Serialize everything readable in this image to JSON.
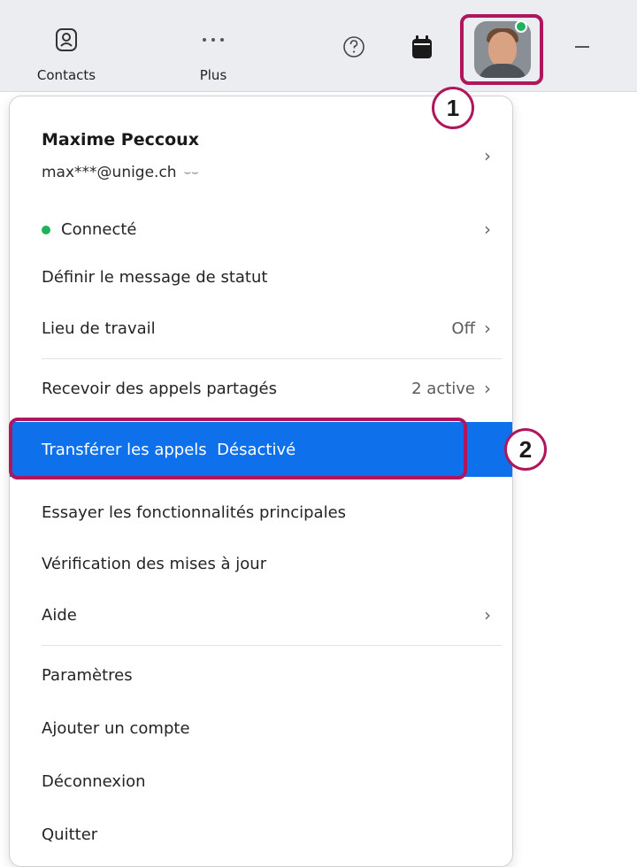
{
  "toolbar": {
    "contacts_label": "Contacts",
    "plus_label": "Plus"
  },
  "annotations": {
    "badge_1": "1",
    "badge_2": "2",
    "highlight_color": "#b0165c"
  },
  "profile": {
    "name": "Maxime Peccoux",
    "email": "max***@unige.ch",
    "presence_color": "#21b35b"
  },
  "menu": {
    "status": "Connecté",
    "set_status_message": "Définir le message de statut",
    "workplace": {
      "label": "Lieu de travail",
      "value": "Off"
    },
    "shared_calls": {
      "label": "Recevoir des appels partagés",
      "value": "2 active"
    },
    "forward_calls": {
      "label": "Transférer les appels",
      "value": "Désactivé"
    },
    "try_features": "Essayer les fonctionnalités principales",
    "check_updates": "Vérification des mises à jour",
    "help": "Aide",
    "settings": "Paramètres",
    "add_account": "Ajouter un compte",
    "sign_out": "Déconnexion",
    "quit": "Quitter"
  },
  "colors": {
    "selected_bg": "#0e71eb",
    "toolbar_bg": "#ecedf0"
  }
}
